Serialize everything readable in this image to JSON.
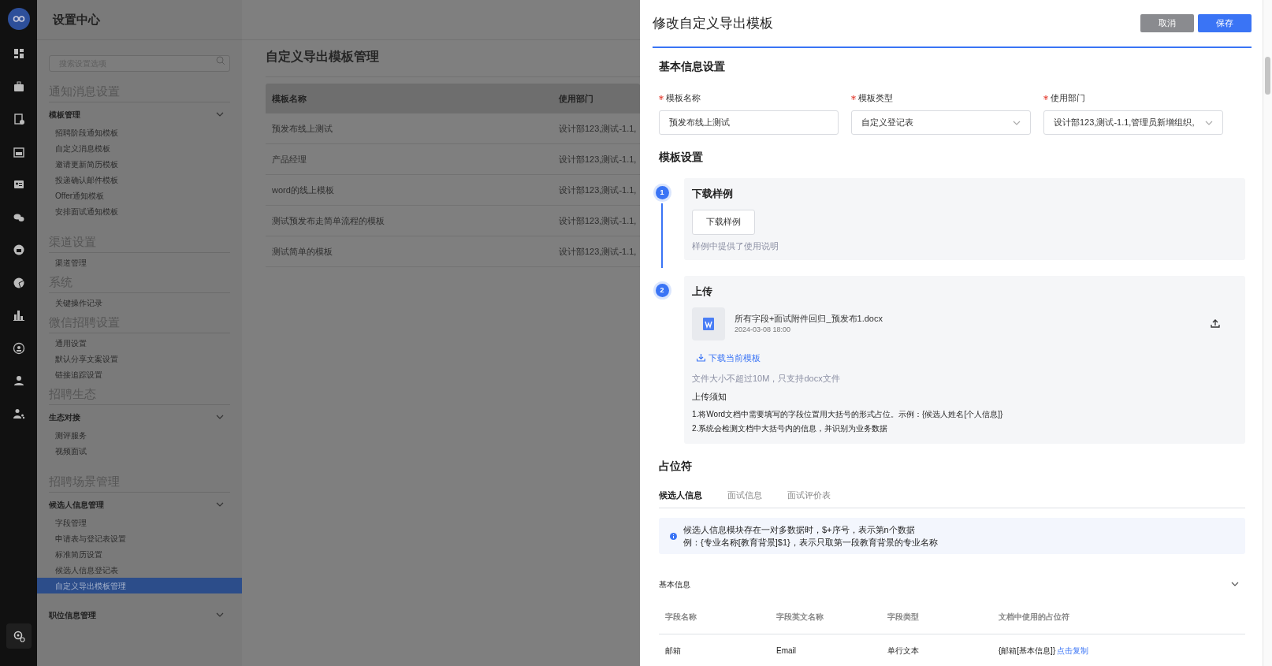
{
  "nav_rail": [
    {
      "selected": false
    },
    {
      "selected": false
    },
    {
      "selected": false
    },
    {
      "selected": false
    },
    {
      "selected": false
    },
    {
      "selected": false
    },
    {
      "selected": false
    },
    {
      "selected": false
    },
    {
      "selected": false
    },
    {
      "selected": false
    },
    {
      "selected": false
    },
    {
      "selected": false
    },
    {
      "selected": true
    }
  ],
  "settings": {
    "title": "设置中心",
    "search": {
      "placeholder": "搜索设置选项"
    },
    "sections": [
      {
        "heading": "通知消息设置",
        "groups": [
          {
            "title": "模板管理",
            "items": [
              {
                "label": "招聘阶段通知模板",
                "selected": false
              },
              {
                "label": "自定义消息模板",
                "selected": false
              },
              {
                "label": "邀请更新简历模板",
                "selected": false
              },
              {
                "label": "投递确认邮件模板",
                "selected": false
              },
              {
                "label": "Offer通知模板",
                "selected": false
              },
              {
                "label": "安排面试通知模板",
                "selected": false
              }
            ]
          }
        ]
      },
      {
        "heading": "渠道设置",
        "items": [
          {
            "label": "渠道管理",
            "selected": false
          }
        ]
      },
      {
        "heading": "系统",
        "items": [
          {
            "label": "关键操作记录",
            "selected": false
          }
        ]
      },
      {
        "heading": "微信招聘设置",
        "items": [
          {
            "label": "通用设置",
            "selected": false
          },
          {
            "label": "默认分享文案设置",
            "selected": false
          },
          {
            "label": "链接追踪设置",
            "selected": false
          }
        ]
      },
      {
        "heading": "招聘生态",
        "groups": [
          {
            "title": "生态对接",
            "items": [
              {
                "label": "测评服务",
                "selected": false
              },
              {
                "label": "视频面试",
                "selected": false
              }
            ]
          }
        ]
      },
      {
        "heading": "招聘场景管理",
        "groups": [
          {
            "title": "候选人信息管理",
            "items": [
              {
                "label": "字段管理",
                "selected": false
              },
              {
                "label": "申请表与登记表设置",
                "selected": false
              },
              {
                "label": "标准简历设置",
                "selected": false
              },
              {
                "label": "候选人信息登记表",
                "selected": false
              },
              {
                "label": "自定义导出模板管理",
                "selected": true
              }
            ]
          },
          {
            "title": "职位信息管理"
          }
        ]
      }
    ]
  },
  "page": {
    "title": "自定义导出模板管理",
    "table": {
      "columns": [
        "模板名称",
        "使用部门"
      ],
      "rows": [
        [
          "预发布线上测试",
          "设计部123,测试-1.1,"
        ],
        [
          "产品经理",
          "设计部123,测试-1.1,"
        ],
        [
          "word的线上模板",
          "设计部123,测试-1.1,"
        ],
        [
          "测试预发布走简单流程的模板",
          "设计部123,测试-1.1,"
        ],
        [
          "测试简单的模板",
          "设计部123,测试-1.1,"
        ]
      ]
    }
  },
  "drawer": {
    "title": "修改自定义导出模板",
    "buttons": [
      {
        "label": "取消",
        "kind": "secondary"
      },
      {
        "label": "保存",
        "kind": "primary"
      }
    ],
    "basic": {
      "heading": "基本信息设置",
      "fields": [
        {
          "label": "模板名称",
          "required": true,
          "kind": "text",
          "value": "预发布线上测试"
        },
        {
          "label": "模板类型",
          "required": true,
          "kind": "select",
          "value": "自定义登记表"
        },
        {
          "label": "使用部门",
          "required": true,
          "kind": "select",
          "value": "设计部123,测试-1.1,管理员新增组织,"
        }
      ]
    },
    "template_settings": {
      "heading": "模板设置",
      "steps": [
        {
          "kind": "download",
          "number": "1",
          "title": "下载样例",
          "button": "下载样例",
          "hint": "样例中提供了使用说明"
        },
        {
          "kind": "upload",
          "number": "2",
          "title": "上传",
          "file": {
            "name": "所有字段+面试附件回归_预发布1.docx",
            "time": "2024-03-08 18:00"
          },
          "link": "下载当前模板",
          "limit": "文件大小不超过10M，只支持docx文件",
          "notice_title": "上传须知",
          "notices": [
            "1.将Word文档中需要填写的字段位置用大括号的形式占位。示例：{候选人姓名[个人信息]}",
            "2.系统会检测文档中大括号内的信息，并识别为业务数据"
          ]
        }
      ]
    },
    "placeholders": {
      "heading": "占位符",
      "tabs": [
        {
          "label": "候选人信息",
          "selected": true
        },
        {
          "label": "面试信息",
          "selected": false
        },
        {
          "label": "面试评价表",
          "selected": false
        }
      ],
      "info": [
        "候选人信息模块存在一对多数据时，$+序号，表示第n个数据",
        "例：{专业名称[教育背景]$1}，表示只取第一段教育背景的专业名称"
      ],
      "group": {
        "title": "基本信息",
        "columns": [
          "字段名称",
          "字段英文名称",
          "字段类型",
          "文档中使用的占位符"
        ],
        "rows": [
          {
            "cells": [
              "邮箱",
              "Email",
              "单行文本",
              "{邮箱[基本信息]}"
            ],
            "action": "点击复制"
          }
        ]
      }
    }
  }
}
